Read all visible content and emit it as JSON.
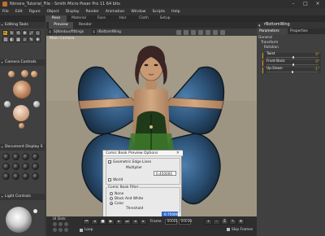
{
  "window": {
    "title": "Nimora_Tutorial_File - Smith Micro Poser Pro 11 64 bits"
  },
  "menubar": {
    "items": [
      "File",
      "Edit",
      "Figure",
      "Object",
      "Display",
      "Render",
      "Animation",
      "Window",
      "Scripts",
      "Help"
    ]
  },
  "room_tabs": [
    "Pose",
    "Material",
    "Face",
    "Hair",
    "Cloth",
    "Setup"
  ],
  "left_panel": {
    "editing_tools_title": "Editing Tools",
    "camera_controls_title": "Camera Controls",
    "document_display_title": "Document Display S",
    "light_controls_title": "Light Controls"
  },
  "viewport": {
    "tabs": [
      "Preview",
      "Render"
    ],
    "toolbar_figure": "S|Nimbur/fittings",
    "toolbar_part": "rBottomWing",
    "camera_label": "Main Camera"
  },
  "comic_dialog": {
    "title": "Comic Book Preview Options",
    "geometric_edge_lines_label": "Geometric Edge Lines",
    "geometric_edge_lines_checked": true,
    "multiplier_label": "Multiplier",
    "multiplier_value": "0.450000",
    "world_label": "World",
    "world_checked": false,
    "filter_title": "Comic Book Filter",
    "filter_options": [
      "None",
      "Black And White",
      "Color"
    ],
    "filter_selected": "Color",
    "threshold_label": "Threshold",
    "threshold_value": "0.750000",
    "close_glyph": "×"
  },
  "timeline": {
    "ui_dots_label": "UI Dots",
    "frame_label": "Frame",
    "frame_current": "00001",
    "frame_total": "00030",
    "loop_label": "Loop",
    "skip_frames_label": "Skip Frames"
  },
  "right_panel": {
    "title": "rBottomWing",
    "tabs": [
      "Parameters",
      "Properties"
    ],
    "tree": [
      "General",
      "Transform",
      "Rotation"
    ],
    "params": [
      {
        "label": "Twist",
        "value": "0°",
        "level": 0.5
      },
      {
        "label": "Front-Back",
        "value": "0°",
        "level": 0.5
      },
      {
        "label": "Up-Down",
        "value": "-1°",
        "level": 0.48
      }
    ]
  },
  "colors": {
    "accent": "#d6a21a",
    "dialog_highlight": "#3874d8",
    "viewport_bg": "#9d9482"
  }
}
